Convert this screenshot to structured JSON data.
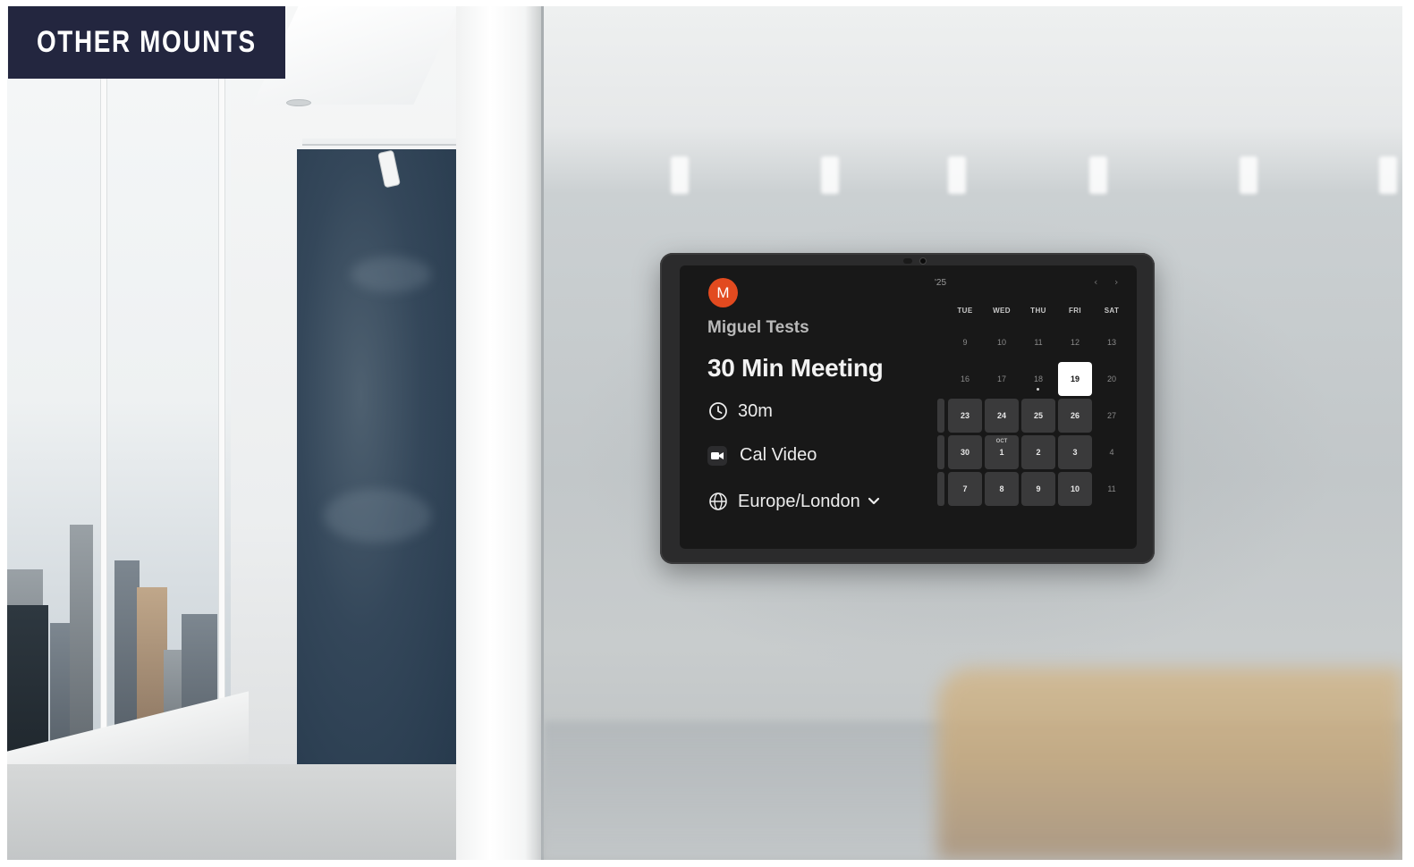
{
  "banner": {
    "label": "OTHER MOUNTS"
  },
  "booking": {
    "avatar_initial": "M",
    "host_name": "Miguel Tests",
    "event_title": "30 Min Meeting",
    "duration": "30m",
    "location": "Cal Video",
    "timezone": "Europe/London"
  },
  "calendar": {
    "month_label": "'25",
    "prev_symbol": "‹",
    "next_symbol": "›",
    "weekdays": [
      "TUE",
      "WED",
      "THU",
      "FRI",
      "SAT"
    ],
    "rows": [
      [
        {
          "d": "9"
        },
        {
          "d": "10"
        },
        {
          "d": "11"
        },
        {
          "d": "12"
        },
        {
          "d": "13"
        }
      ],
      [
        {
          "d": "16"
        },
        {
          "d": "17"
        },
        {
          "d": "18",
          "dot": true
        },
        {
          "d": "19",
          "state": "selected"
        },
        {
          "d": "20"
        }
      ],
      [
        {
          "d": "23",
          "state": "avail"
        },
        {
          "d": "24",
          "state": "avail"
        },
        {
          "d": "25",
          "state": "avail"
        },
        {
          "d": "26",
          "state": "avail"
        },
        {
          "d": "27"
        }
      ],
      [
        {
          "d": "30",
          "state": "avail"
        },
        {
          "d": "1",
          "state": "avail",
          "sup": "OCT"
        },
        {
          "d": "2",
          "state": "avail"
        },
        {
          "d": "3",
          "state": "avail"
        },
        {
          "d": "4"
        }
      ],
      [
        {
          "d": "7",
          "state": "avail"
        },
        {
          "d": "8",
          "state": "avail"
        },
        {
          "d": "9",
          "state": "avail"
        },
        {
          "d": "10",
          "state": "avail"
        },
        {
          "d": "11"
        }
      ]
    ]
  },
  "colors": {
    "banner_bg": "#23263f",
    "avatar_bg": "#e24a1f",
    "screen_bg": "#181818",
    "available_day_bg": "#3a3a3b",
    "selected_day_bg": "#ffffff"
  },
  "icons": {
    "duration": "clock-icon",
    "location": "video-camera-icon",
    "timezone": "globe-icon",
    "timezone_toggle": "chevron-down-icon"
  }
}
